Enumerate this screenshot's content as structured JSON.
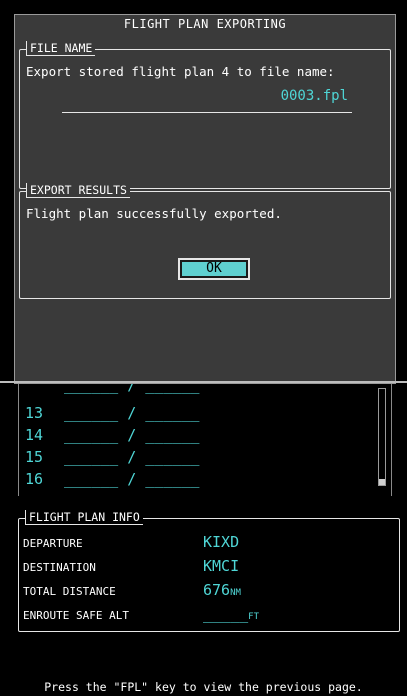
{
  "dialog": {
    "title": "FLIGHT PLAN EXPORTING",
    "file_name_group": {
      "title": "FILE NAME",
      "prompt": "Export stored flight plan 4 to file name:",
      "filename_value": "0003.fpl"
    },
    "export_results_group": {
      "title": "EXPORT RESULTS",
      "message": "Flight plan successfully exported.",
      "ok_label": "OK"
    }
  },
  "waypoints": [
    {
      "num": "13",
      "value": "______ / ______"
    },
    {
      "num": "14",
      "value": "______ / ______"
    },
    {
      "num": "15",
      "value": "______ / ______"
    },
    {
      "num": "16",
      "value": "______ / ______"
    }
  ],
  "flight_plan_info": {
    "title": "FLIGHT PLAN INFO",
    "rows": [
      {
        "label": "DEPARTURE",
        "value": "KIXD",
        "unit": ""
      },
      {
        "label": "DESTINATION",
        "value": "KMCI",
        "unit": ""
      },
      {
        "label": "TOTAL DISTANCE",
        "value": "676",
        "unit": "NM"
      },
      {
        "label": "ENROUTE SAFE ALT",
        "value": "_____",
        "unit": "FT"
      }
    ]
  },
  "footer": {
    "hint": "Press the \"FPL\" key to view the previous page."
  },
  "colors": {
    "accent_cyan": "#4fd6d6",
    "dialog_bg": "#3a3a3a",
    "screen_bg": "#000000"
  }
}
